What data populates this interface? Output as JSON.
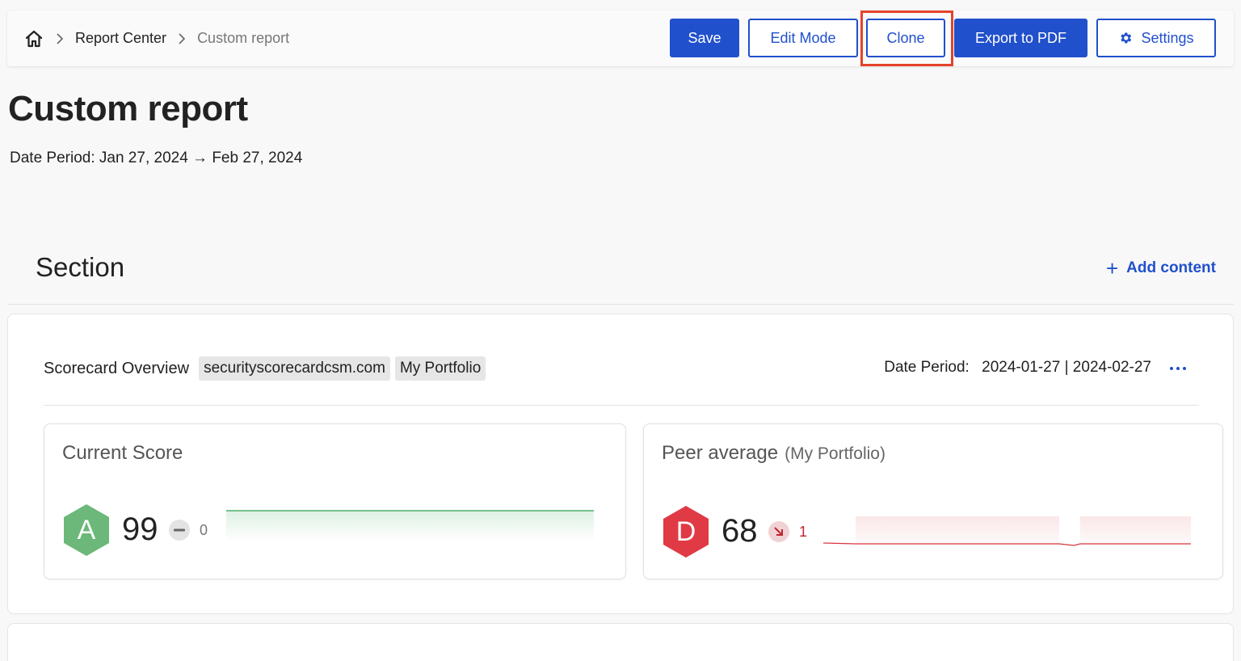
{
  "breadcrumb": {
    "home_icon": "home-icon",
    "items": [
      "Report Center",
      "Custom report"
    ]
  },
  "toolbar": {
    "save_label": "Save",
    "edit_mode_label": "Edit Mode",
    "clone_label": "Clone",
    "export_label": "Export to PDF",
    "settings_label": "Settings",
    "settings_icon": "gear-icon",
    "highlight_color": "#e5432b"
  },
  "page": {
    "title": "Custom report",
    "date_period": "Date Period: Jan 27, 2024 → Feb 27, 2024"
  },
  "section": {
    "title": "Section",
    "add_content_label": "Add content"
  },
  "widget": {
    "title": "Scorecard Overview",
    "tags": [
      "securityscorecardcsm.com",
      "My Portfolio"
    ],
    "date_label": "Date Period:",
    "date_value": "2024-01-27 | 2024-02-27",
    "more_icon": "more-horizontal-icon"
  },
  "current_score": {
    "title": "Current Score",
    "grade": "A",
    "grade_color": "#6cb87a",
    "score": "99",
    "trend_icon": "no-change-icon",
    "trend_value": "0",
    "line_color": "#4caf6a"
  },
  "peer_average": {
    "title": "Peer average",
    "subtitle": "(My Portfolio)",
    "grade": "D",
    "grade_color": "#e03a45",
    "score": "68",
    "trend_icon": "arrow-down-right-icon",
    "trend_value": "1",
    "line_color": "#d9363e"
  },
  "accent_color": "#2150cc"
}
